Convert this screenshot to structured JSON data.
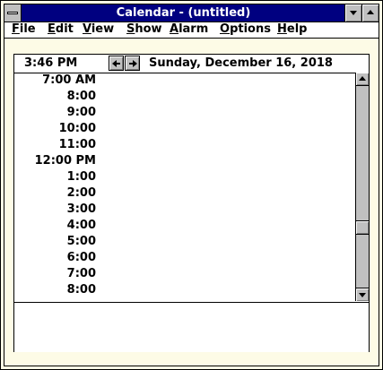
{
  "window": {
    "title": "Calendar - (untitled)"
  },
  "menu": {
    "items": [
      {
        "label": "File",
        "mnemonic": "F",
        "rest": "ile"
      },
      {
        "label": "Edit",
        "mnemonic": "E",
        "rest": "dit"
      },
      {
        "label": "View",
        "mnemonic": "V",
        "rest": "iew"
      },
      {
        "label": "Show",
        "mnemonic": "S",
        "rest": "how"
      },
      {
        "label": "Alarm",
        "mnemonic": "A",
        "rest": "larm"
      },
      {
        "label": "Options",
        "mnemonic": "O",
        "rest": "ptions"
      },
      {
        "label": "Help",
        "mnemonic": "H",
        "rest": "elp"
      }
    ]
  },
  "status": {
    "current_time": "3:46 PM",
    "date": "Sunday, December 16, 2018"
  },
  "schedule": {
    "times": [
      "7:00 AM",
      "8:00",
      "9:00",
      "10:00",
      "11:00",
      "12:00 PM",
      "1:00",
      "2:00",
      "3:00",
      "4:00",
      "5:00",
      "6:00",
      "7:00",
      "8:00"
    ]
  },
  "scroll": {
    "position_fraction": 0.72
  },
  "icons": {
    "system_menu": "system-menu-icon",
    "minimize": "minimize-icon",
    "maximize": "maximize-icon",
    "prev_day": "left-arrow-icon",
    "next_day": "right-arrow-icon",
    "scroll_up": "scroll-up-icon",
    "scroll_down": "scroll-down-icon"
  },
  "colors": {
    "titlebar": "#000080",
    "window_background": "#fdfbe6",
    "button_face": "#c0c0c0"
  }
}
